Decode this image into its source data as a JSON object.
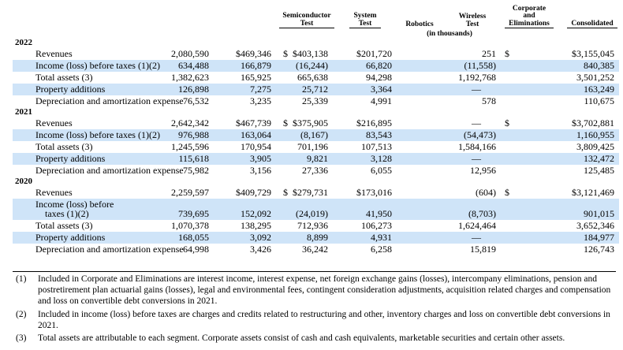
{
  "columns": {
    "semiconductor": [
      "Semiconductor",
      "Test"
    ],
    "system": [
      "System",
      "Test"
    ],
    "robotics": "Robotics",
    "wireless": [
      "Wireless",
      "Test"
    ],
    "corporate": [
      "Corporate",
      "and",
      "Eliminations"
    ],
    "consolidated": "Consolidated",
    "units": "(in thousands)"
  },
  "years": [
    {
      "year": "2022",
      "rows": [
        {
          "label": "Revenues",
          "v": [
            "$",
            "2,080,590",
            "$469,346",
            "$403,138",
            "$201,720",
            "$",
            "251",
            "$3,155,045"
          ]
        },
        {
          "label": "Income (loss) before taxes (1)(2)",
          "v": [
            "",
            "634,488",
            "166,879",
            "(16,244)",
            "66,820",
            "",
            "(11,558)",
            "840,385"
          ]
        },
        {
          "label": "Total assets (3)",
          "v": [
            "",
            "1,382,623",
            "165,925",
            "665,638",
            "94,298",
            "",
            "1,192,768",
            "3,501,252"
          ]
        },
        {
          "label": "Property additions",
          "v": [
            "",
            "126,898",
            "7,275",
            "25,712",
            "3,364",
            "",
            "—",
            "163,249"
          ]
        },
        {
          "label": "Depreciation and amortization expense",
          "v": [
            "",
            "76,532",
            "3,235",
            "25,339",
            "4,991",
            "",
            "578",
            "110,675"
          ]
        }
      ]
    },
    {
      "year": "2021",
      "rows": [
        {
          "label": "Revenues",
          "v": [
            "$",
            "2,642,342",
            "$467,739",
            "$375,905",
            "$216,895",
            "$",
            "—",
            "$3,702,881"
          ]
        },
        {
          "label": "Income (loss) before taxes (1)(2)",
          "v": [
            "",
            "976,988",
            "163,064",
            "(8,167)",
            "83,543",
            "",
            "(54,473)",
            "1,160,955"
          ]
        },
        {
          "label": "Total assets (3)",
          "v": [
            "",
            "1,245,596",
            "170,954",
            "701,196",
            "107,513",
            "",
            "1,584,166",
            "3,809,425"
          ]
        },
        {
          "label": "Property additions",
          "v": [
            "",
            "115,618",
            "3,905",
            "9,821",
            "3,128",
            "",
            "—",
            "132,472"
          ]
        },
        {
          "label": "Depreciation and amortization expense",
          "v": [
            "",
            "75,982",
            "3,156",
            "27,336",
            "6,055",
            "",
            "12,956",
            "125,485"
          ]
        }
      ]
    },
    {
      "year": "2020",
      "rows": [
        {
          "label": "Revenues",
          "v": [
            "$",
            "2,259,597",
            "$409,729",
            "$279,731",
            "$173,016",
            "$",
            "(604)",
            "$3,121,469"
          ]
        },
        {
          "label": "Income (loss) before",
          "label2": "taxes (1)(2)",
          "v": [
            "",
            "739,695",
            "152,092",
            "(24,019)",
            "41,950",
            "",
            "(8,703)",
            "901,015"
          ]
        },
        {
          "label": "Total assets (3)",
          "v": [
            "",
            "1,070,378",
            "138,295",
            "712,936",
            "106,273",
            "",
            "1,624,464",
            "3,652,346"
          ]
        },
        {
          "label": "Property additions",
          "v": [
            "",
            "168,055",
            "3,092",
            "8,899",
            "4,931",
            "",
            "—",
            "184,977"
          ]
        },
        {
          "label": "Depreciation and amortization expense",
          "v": [
            "",
            "64,998",
            "3,426",
            "36,242",
            "6,258",
            "",
            "15,819",
            "126,743"
          ]
        }
      ]
    }
  ],
  "notes": [
    {
      "num": "(1)",
      "text": "Included in Corporate and Eliminations are interest income, interest expense, net foreign exchange gains (losses), intercompany eliminations, pension and postretirement plan actuarial gains (losses), legal and environmental fees, contingent consideration adjustments, acquisition related charges and compensation and loss on convertible debt conversions in 2021."
    },
    {
      "num": "(2)",
      "text": "Included in income (loss) before taxes are charges and credits related to restructuring and other, inventory charges and loss on convertible debt conversions in 2021."
    },
    {
      "num": "(3)",
      "text": "Total assets are attributable to each segment. Corporate assets consist of cash and cash equivalents, marketable securities and certain other assets."
    }
  ]
}
